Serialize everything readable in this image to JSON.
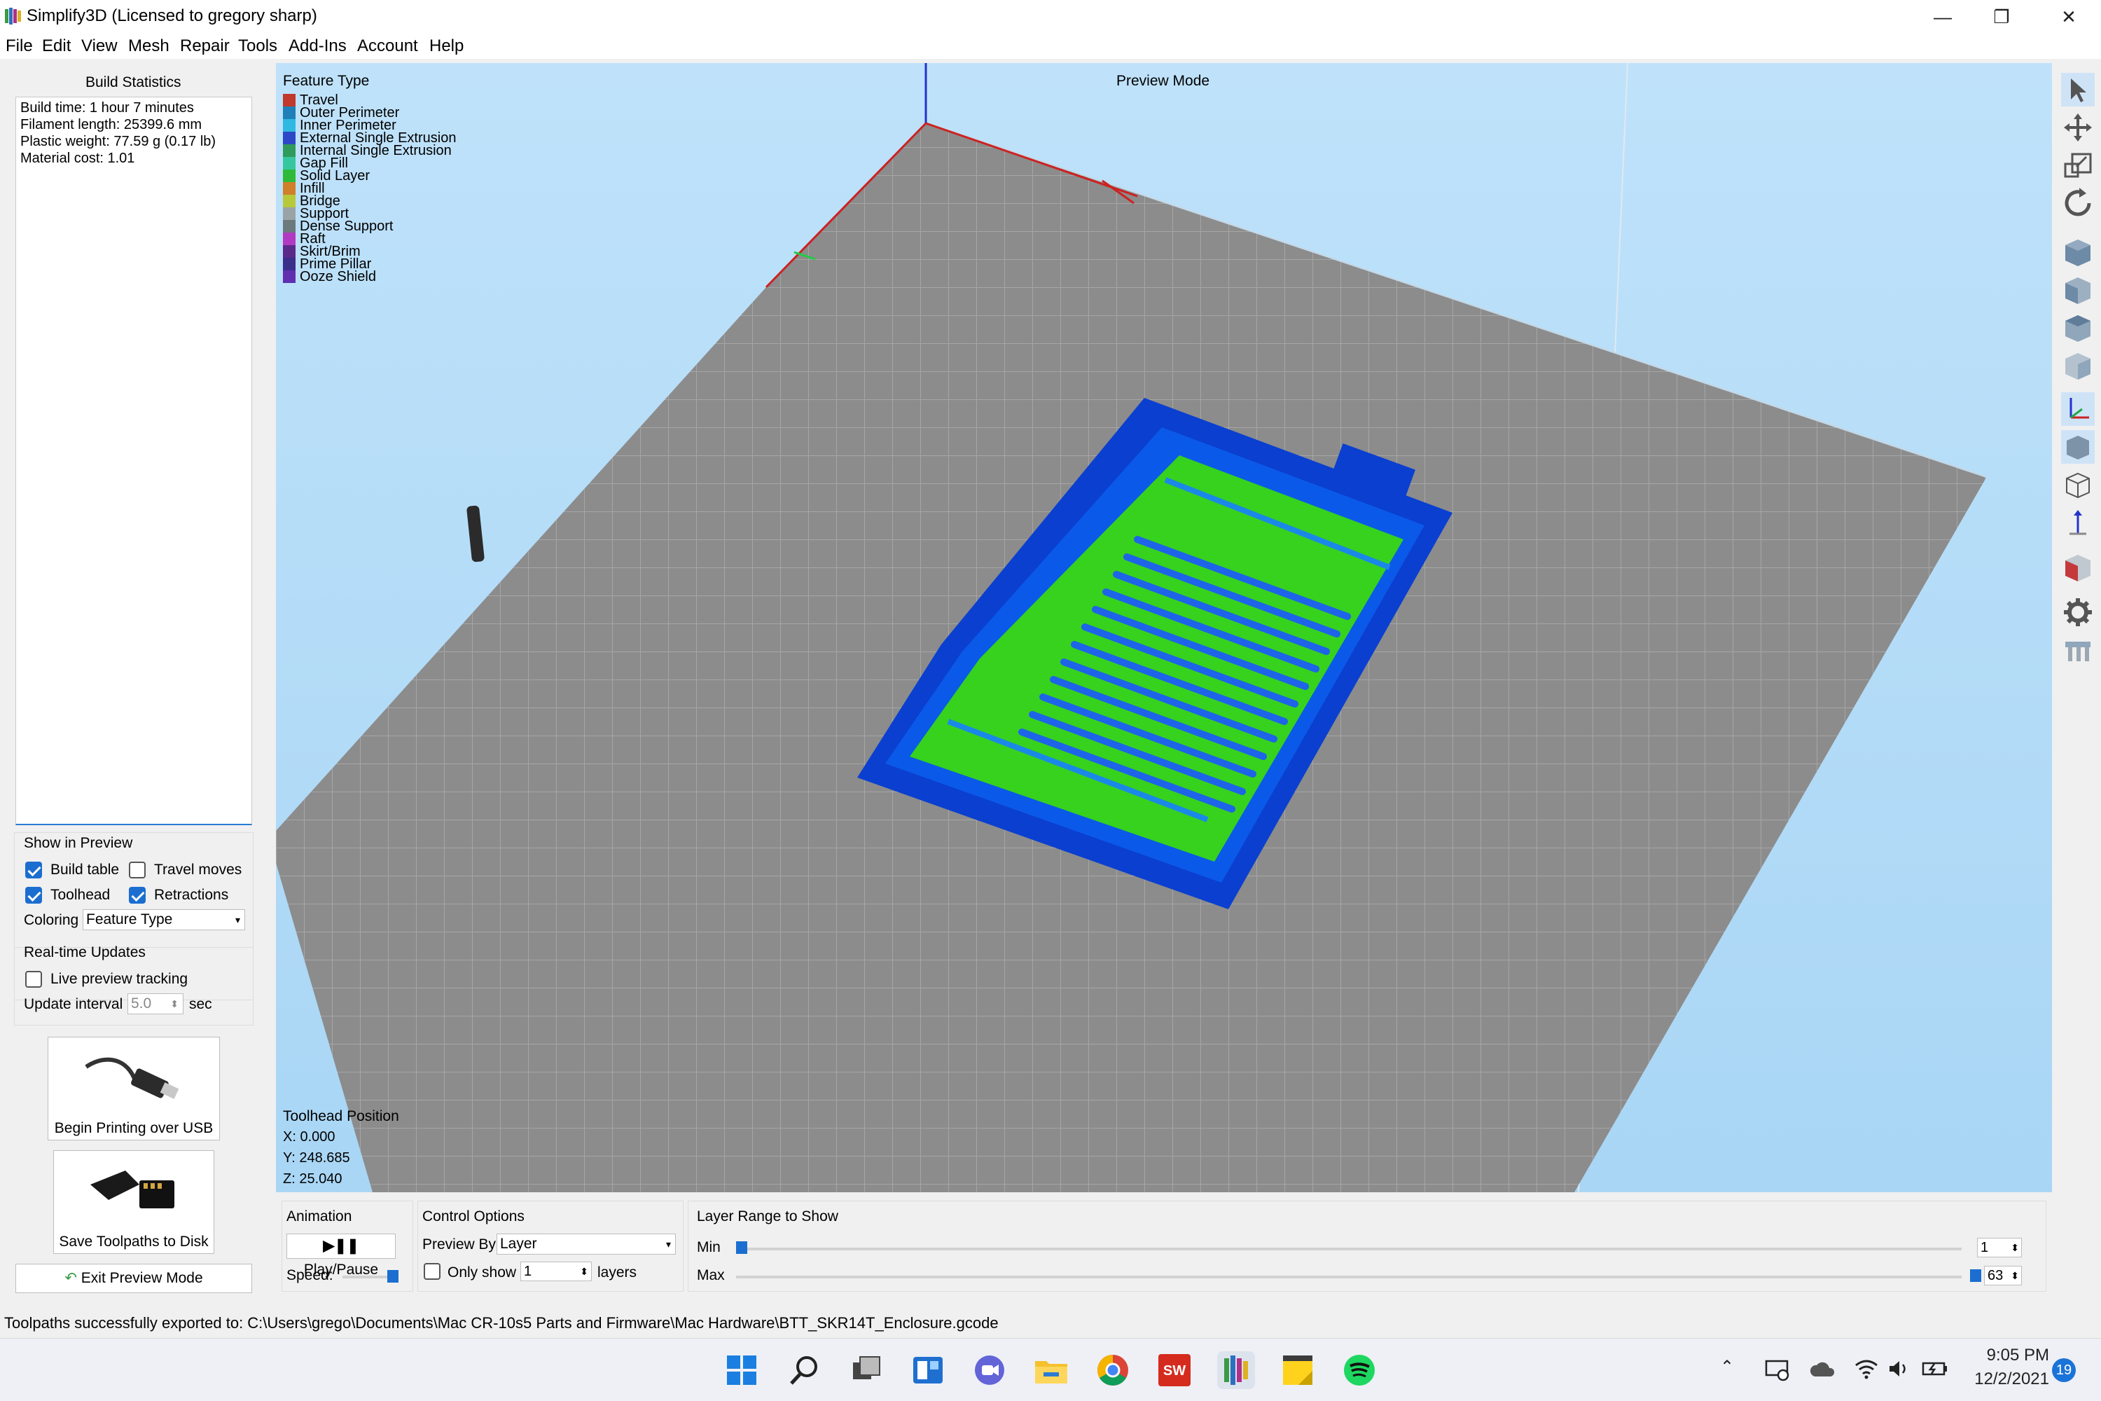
{
  "window": {
    "title": "Simplify3D (Licensed to gregory sharp)",
    "controls": {
      "minimize": "—",
      "restore": "❐",
      "close": "✕"
    }
  },
  "menu": [
    "File",
    "Edit",
    "View",
    "Mesh",
    "Repair",
    "Tools",
    "Add-Ins",
    "Account",
    "Help"
  ],
  "build_statistics": {
    "title": "Build Statistics",
    "lines": [
      "Build time: 1 hour 7 minutes",
      "Filament length: 25399.6 mm",
      "Plastic weight: 77.59 g (0.17 lb)",
      "Material cost: 1.01"
    ]
  },
  "show_in_preview": {
    "title": "Show in Preview",
    "build_table": {
      "label": "Build table",
      "checked": true
    },
    "travel_moves": {
      "label": "Travel moves",
      "checked": false
    },
    "toolhead": {
      "label": "Toolhead",
      "checked": true
    },
    "retractions": {
      "label": "Retractions",
      "checked": true
    },
    "coloring_label": "Coloring",
    "coloring_value": "Feature Type"
  },
  "realtime_updates": {
    "title": "Real-time Updates",
    "live_tracking": {
      "label": "Live preview tracking",
      "checked": false
    },
    "interval_label": "Update interval",
    "interval_value": "5.0",
    "interval_unit": "sec"
  },
  "actions": {
    "usb": "Begin Printing over USB",
    "disk": "Save Toolpaths to Disk",
    "exit": "Exit Preview Mode"
  },
  "viewport": {
    "legend_title": "Feature Type",
    "legend": [
      {
        "label": "Travel",
        "color": "#c0392b"
      },
      {
        "label": "Outer Perimeter",
        "color": "#1f7fb8"
      },
      {
        "label": "Inner Perimeter",
        "color": "#2fb9e0"
      },
      {
        "label": "External Single Extrusion",
        "color": "#2d48c7"
      },
      {
        "label": "Internal Single Extrusion",
        "color": "#2e9a5b"
      },
      {
        "label": "Gap Fill",
        "color": "#37c7a0"
      },
      {
        "label": "Solid Layer",
        "color": "#2fba3a"
      },
      {
        "label": "Infill",
        "color": "#d07f2a"
      },
      {
        "label": "Bridge",
        "color": "#b7c83a"
      },
      {
        "label": "Support",
        "color": "#9aa4a6"
      },
      {
        "label": "Dense Support",
        "color": "#6c7a7d"
      },
      {
        "label": "Raft",
        "color": "#b23ac2"
      },
      {
        "label": "Skirt/Brim",
        "color": "#5a2a8a"
      },
      {
        "label": "Prime Pillar",
        "color": "#3a2f8a"
      },
      {
        "label": "Ooze Shield",
        "color": "#5f2fb0"
      }
    ],
    "mode_label": "Preview Mode",
    "toolhead_title": "Toolhead Position",
    "x": "X: 0.000",
    "y": "Y: 248.685",
    "z": "Z: 25.040"
  },
  "animation": {
    "title": "Animation",
    "play": "Play/Pause",
    "speed": "Speed:"
  },
  "control_options": {
    "title": "Control Options",
    "preview_by_label": "Preview By",
    "preview_by_value": "Layer",
    "only_show_label": "Only show",
    "only_show_value": "1",
    "layers_label": "layers"
  },
  "layer_range": {
    "title": "Layer Range to Show",
    "min_label": "Min",
    "min_value": "1",
    "max_label": "Max",
    "max_value": "63"
  },
  "status": "Toolpaths successfully exported to: C:\\Users\\grego\\Documents\\Mac CR-10s5 Parts and Firmware\\Mac Hardware\\BTT_SKR14T_Enclosure.gcode",
  "taskbar": {
    "time": "9:05 PM",
    "date": "12/2/2021",
    "notifications": "19",
    "tray_chevron": "⌃"
  }
}
